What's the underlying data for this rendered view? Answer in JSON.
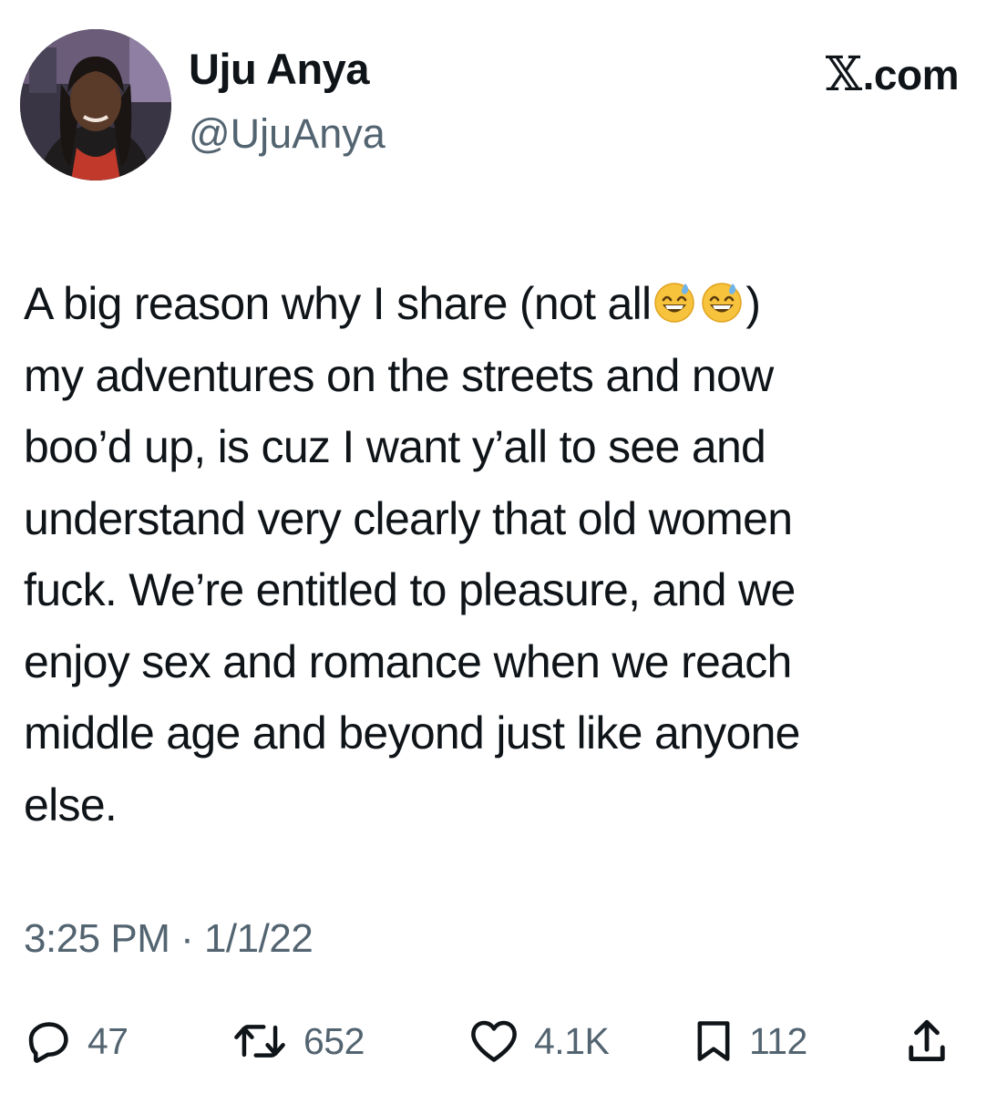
{
  "author": {
    "display_name": "Uju Anya",
    "handle": "@UjuAnya"
  },
  "source": {
    "logo_icon": "x-logo-icon",
    "label": ".com"
  },
  "tweet": {
    "lines": [
      {
        "text": "A big reason why I share (not all",
        "emoji_after": 2,
        "suffix": ")"
      },
      {
        "text": "my adventures on the streets and now"
      },
      {
        "text": "boo’d up, is cuz I want y’all to see and"
      },
      {
        "text": "understand very clearly that old women"
      },
      {
        "text": "fuck. We’re entitled to pleasure, and we"
      },
      {
        "text": "enjoy sex and romance when we reach"
      },
      {
        "text": "middle age and beyond just like anyone"
      },
      {
        "text": "else."
      }
    ],
    "emoji": "grinning-face-with-sweat-emoji",
    "timestamp": "3:25 PM · 1/1/22"
  },
  "actions": {
    "reply": {
      "icon": "reply-icon",
      "count": "47"
    },
    "retweet": {
      "icon": "retweet-icon",
      "count": "652"
    },
    "like": {
      "icon": "heart-icon",
      "count": "4.1K"
    },
    "bookmark": {
      "icon": "bookmark-icon",
      "count": "112"
    },
    "share": {
      "icon": "share-icon"
    }
  },
  "colors": {
    "text": "#0f1419",
    "secondary": "#536471",
    "background": "#ffffff"
  }
}
